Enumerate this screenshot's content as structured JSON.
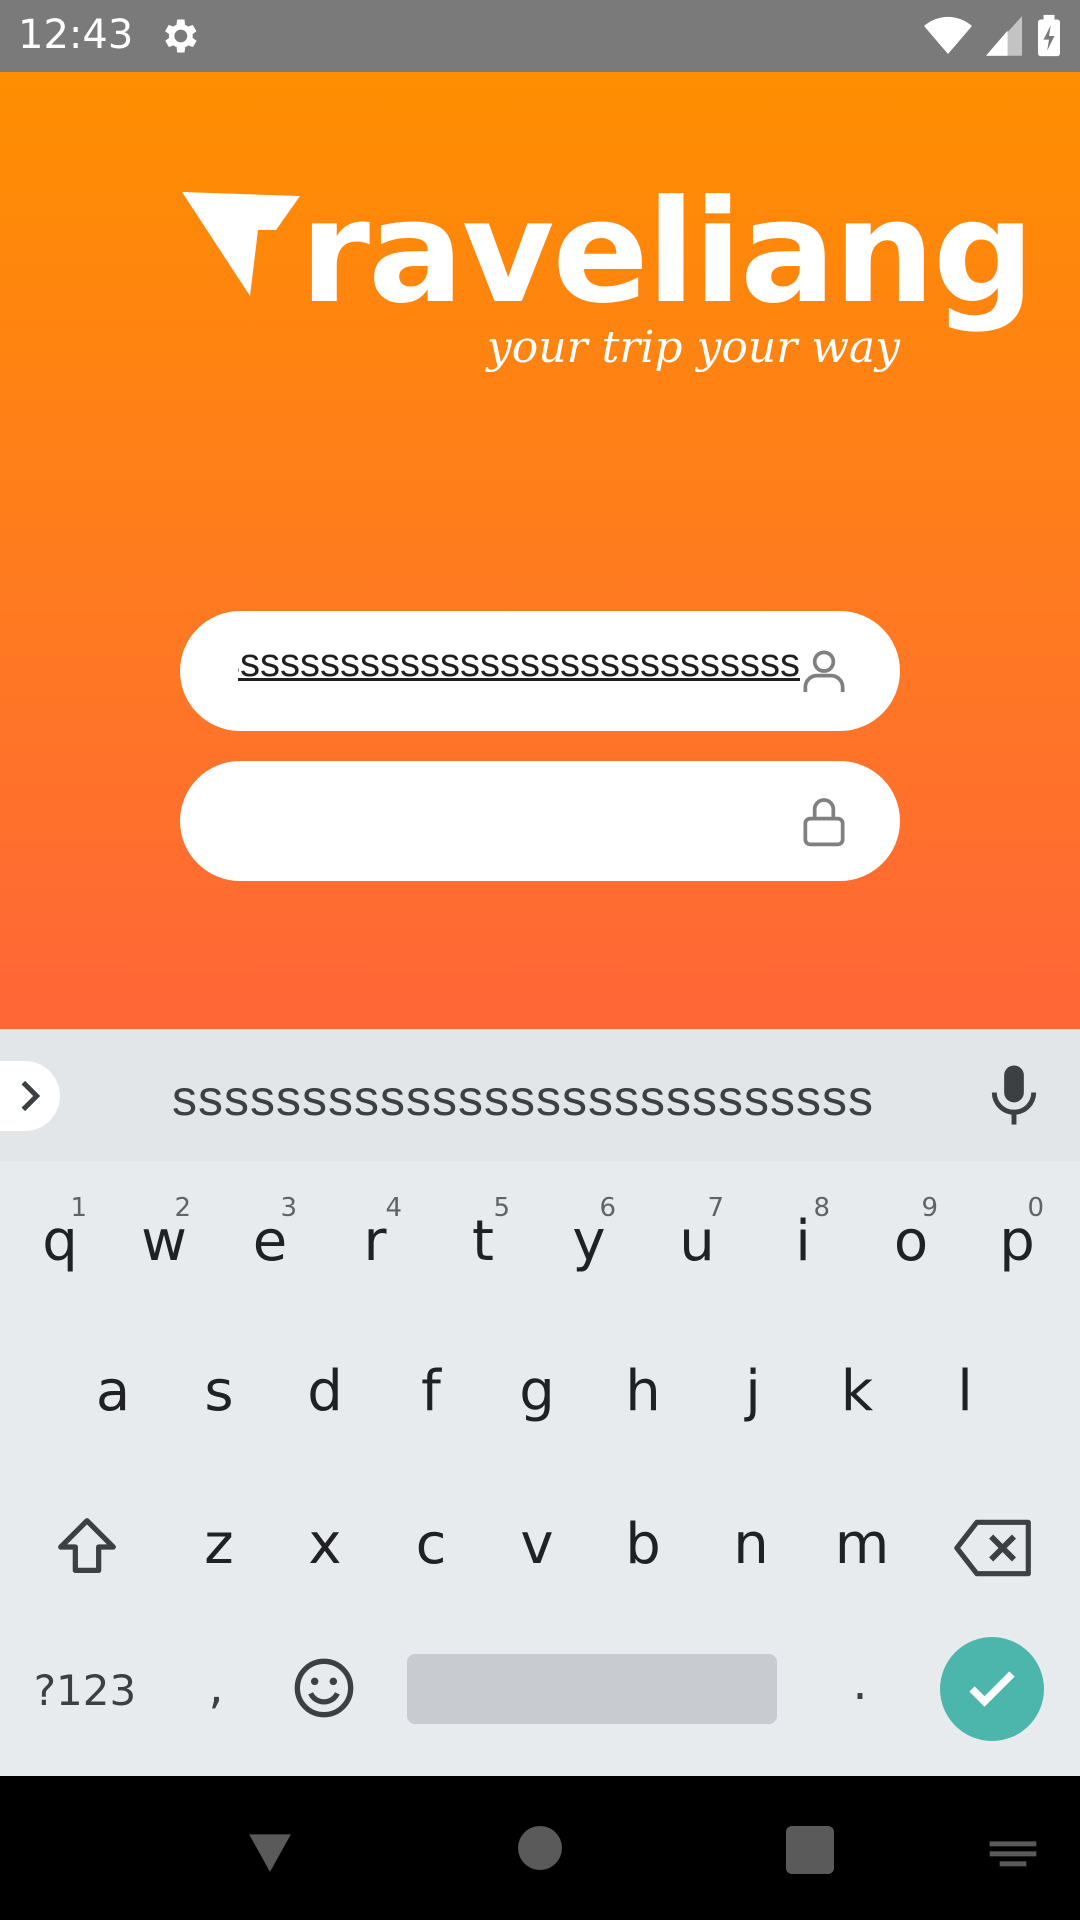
{
  "status_bar": {
    "time": "12:43",
    "icons": [
      "gear-icon",
      "wifi-icon",
      "cellular-icon",
      "battery-charging-icon"
    ]
  },
  "app": {
    "logo_text": "raveliang",
    "tagline": "your trip your way",
    "username_field": {
      "value": "ssssssssssssssssssssssssssssssssss",
      "icon": "user-icon"
    },
    "password_field": {
      "value": "",
      "icon": "lock-icon"
    },
    "colors": {
      "gradient_top": "#ff8e00",
      "gradient_bottom": "#ff6638",
      "accent": "#4db6ac"
    }
  },
  "keyboard": {
    "suggestion": "sssssssssssssssssssssssssss",
    "row1": [
      {
        "k": "q",
        "h": "1"
      },
      {
        "k": "w",
        "h": "2"
      },
      {
        "k": "e",
        "h": "3"
      },
      {
        "k": "r",
        "h": "4"
      },
      {
        "k": "t",
        "h": "5"
      },
      {
        "k": "y",
        "h": "6"
      },
      {
        "k": "u",
        "h": "7"
      },
      {
        "k": "i",
        "h": "8"
      },
      {
        "k": "o",
        "h": "9"
      },
      {
        "k": "p",
        "h": "0"
      }
    ],
    "row2": [
      "a",
      "s",
      "d",
      "f",
      "g",
      "h",
      "j",
      "k",
      "l"
    ],
    "row3": [
      "z",
      "x",
      "c",
      "v",
      "b",
      "n",
      "m"
    ],
    "symbols_label": "?123",
    "comma": ",",
    "period": "."
  }
}
